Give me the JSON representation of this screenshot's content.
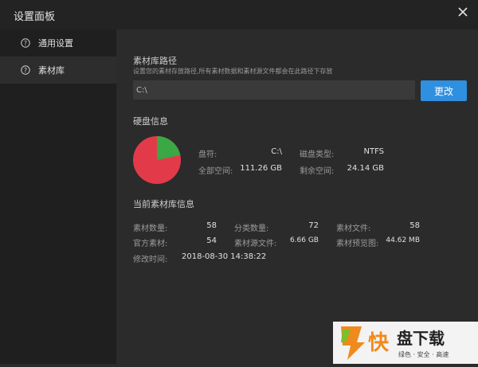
{
  "window": {
    "title": "设置面板",
    "close_icon": "close-icon"
  },
  "sidebar": {
    "items": [
      {
        "label": "通用设置",
        "icon": "question-circle-icon"
      },
      {
        "label": "素材库",
        "icon": "question-circle-icon"
      }
    ]
  },
  "library_path": {
    "title": "素材库路径",
    "description": "设置您的素材存放路径,所有素材数据和素材源文件都会在此路径下存放",
    "value": "C:\\",
    "button": "更改"
  },
  "disk": {
    "title": "硬盘信息",
    "drive_label": "盘符:",
    "drive_value": "C:\\",
    "type_label": "磁盘类型:",
    "type_value": "NTFS",
    "total_label": "全部空间:",
    "total_value": "111.26 GB",
    "free_label": "剩余空间:",
    "free_value": "24.14 GB",
    "free_fraction": 0.217,
    "used_color": "#e33a4a",
    "free_color": "#3aa844"
  },
  "library_info": {
    "title": "当前素材库信息",
    "count_label": "素材数量:",
    "count_value": "58",
    "category_label": "分类数量:",
    "category_value": "72",
    "files_label": "素材文件:",
    "files_value": "58",
    "official_label": "官方素材:",
    "official_value": "54",
    "source_label": "素材源文件:",
    "source_value": "6.66 GB",
    "preview_label": "素材预览图:",
    "preview_value": "44.62 MB",
    "modified_label": "修改时间:",
    "modified_value": "2018-08-30 14:38:22"
  },
  "watermark": {
    "char": "快",
    "brand": "盘下载",
    "slogan": "绿色 · 安全 · 高速",
    "orange": "#f08a1c",
    "green": "#7bbf2a"
  }
}
